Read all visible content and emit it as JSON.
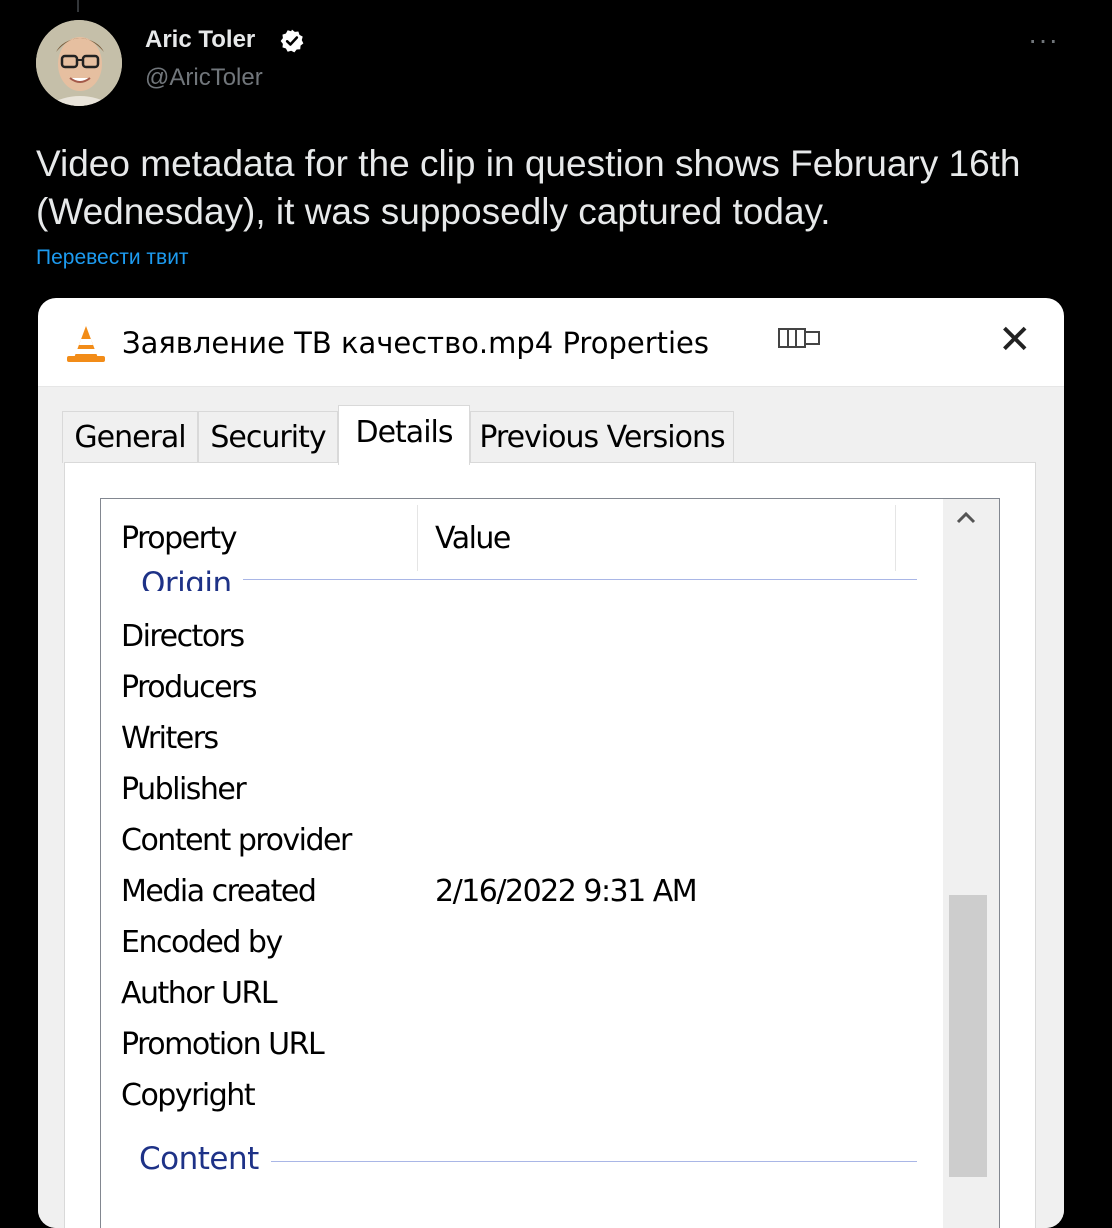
{
  "tweet": {
    "author_name": "Aric Toler",
    "handle": "@AricToler",
    "text": "Video metadata for the clip in question shows February 16th (Wednesday), it was supposedly captured today.",
    "translate_label": "Перевести твит",
    "more_label": "···",
    "verified_color": "#ffffff"
  },
  "dialog": {
    "title": "Заявление ТВ качество.mp4 Properties",
    "close_label": "✕",
    "tabs": [
      {
        "label": "General",
        "active": false
      },
      {
        "label": "Security",
        "active": false
      },
      {
        "label": "Details",
        "active": true
      },
      {
        "label": "Previous Versions",
        "active": false
      }
    ],
    "columns": {
      "property": "Property",
      "value": "Value"
    },
    "groups": {
      "origin": "Origin",
      "content": "Content"
    },
    "properties": [
      {
        "name": "Directors",
        "value": ""
      },
      {
        "name": "Producers",
        "value": ""
      },
      {
        "name": "Writers",
        "value": ""
      },
      {
        "name": "Publisher",
        "value": ""
      },
      {
        "name": "Content provider",
        "value": ""
      },
      {
        "name": "Media created",
        "value": "2/16/2022 9:31 AM"
      },
      {
        "name": "Encoded by",
        "value": ""
      },
      {
        "name": "Author URL",
        "value": ""
      },
      {
        "name": "Promotion URL",
        "value": ""
      },
      {
        "name": "Copyright",
        "value": ""
      }
    ],
    "scroll_up_icon": "chevron-up-icon"
  }
}
